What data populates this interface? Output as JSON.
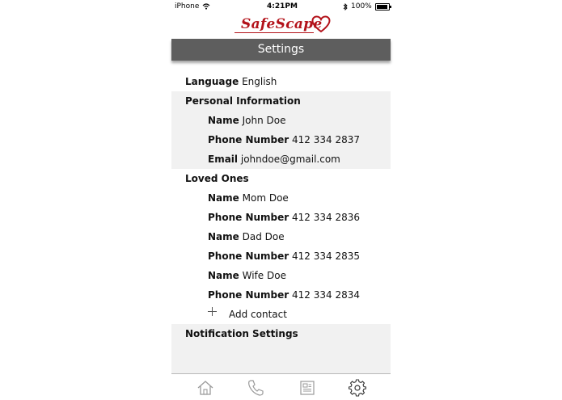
{
  "status_bar": {
    "carrier": "iPhone",
    "time": "4:21PM",
    "battery": "100%"
  },
  "app": {
    "logo_text": "SafeScape",
    "title": "Settings"
  },
  "language": {
    "label": "Language",
    "value": "English"
  },
  "personal": {
    "heading": "Personal Information",
    "name": {
      "label": "Name",
      "value": "John Doe"
    },
    "phone": {
      "label": "Phone Number",
      "value": "412 334 2837"
    },
    "email": {
      "label": "Email",
      "value": "johndoe@gmail.com"
    }
  },
  "loved_ones": {
    "heading": "Loved Ones",
    "contacts": [
      {
        "name_label": "Name",
        "name": "Mom Doe",
        "phone_label": "Phone Number",
        "phone": "412 334 2836"
      },
      {
        "name_label": "Name",
        "name": "Dad Doe",
        "phone_label": "Phone Number",
        "phone": "412 334 2835"
      },
      {
        "name_label": "Name",
        "name": "Wife Doe",
        "phone_label": "Phone Number",
        "phone": "412 334 2834"
      }
    ],
    "add_label": "Add contact"
  },
  "notification": {
    "heading": "Notification Settings"
  },
  "tabbar": {
    "tabs": [
      "home-icon",
      "phone-icon",
      "news-icon",
      "settings-icon"
    ],
    "active": "settings-icon"
  },
  "colors": {
    "brand": "#b3121a",
    "header_bg": "#5e5e5e",
    "section_bg": "#f1f1f1"
  }
}
